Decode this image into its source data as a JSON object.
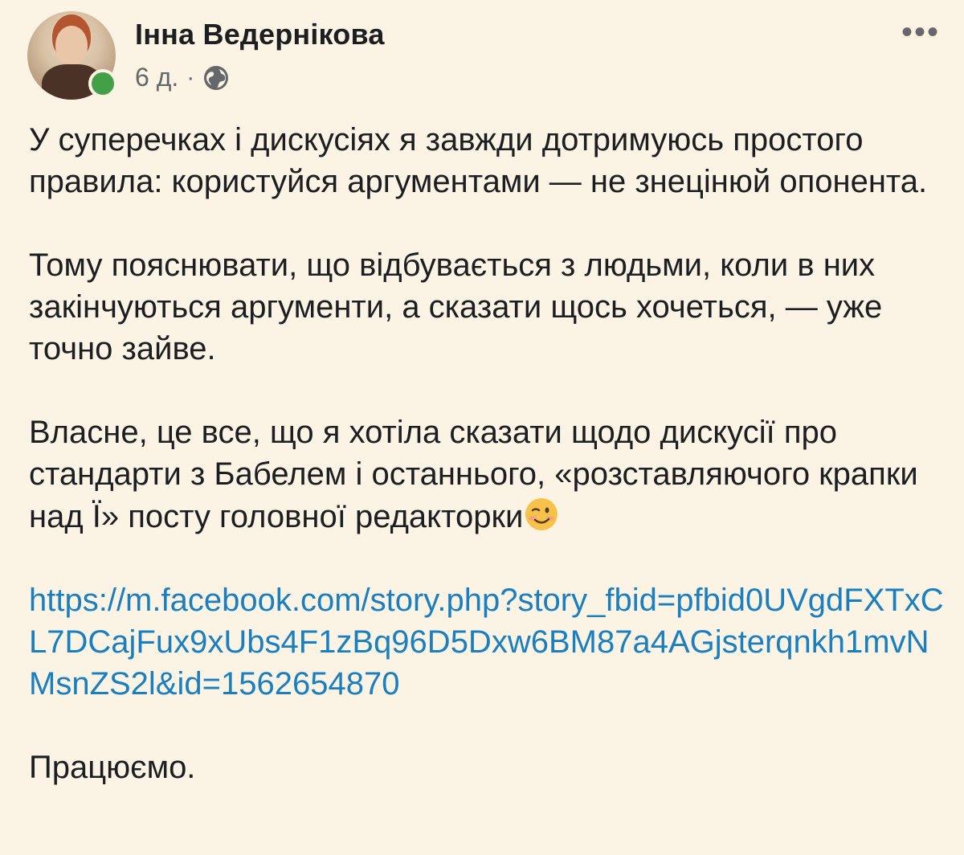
{
  "post": {
    "author": "Інна Ведернікова",
    "time": "6 д.",
    "separator": "·",
    "privacy_icon": "globe-icon",
    "more_icon": "ellipsis-icon",
    "paragraphs": {
      "p1": "У суперечках і дискусіях я завжди дотримуюсь простого правила: користуйся аргументами — не знецінюй опонента.",
      "p2": "Тому пояснювати, що відбувається з людьми, коли в них закінчуються аргументи, а сказати щось хочеться, — уже точно зайве.",
      "p3": "Власне, це все, що я хотіла сказати щодо дискусії про стандарти з Бабелем і останнього, «розставляючого крапки над Ї» посту головної редакторки",
      "p3_emoji": "wink-emoji",
      "link": "https://m.facebook.com/story.php?story_fbid=pfbid0UVgdFXTxCL7DCajFux9xUbs4F1zBq96D5Dxw6BM87a4AGjsterqnkh1mvNMsnZS2l&id=1562654870",
      "p5": "Працюємо."
    }
  },
  "colors": {
    "background": "#fbf3e4",
    "link": "#1a7fc1",
    "online": "#43a047"
  }
}
